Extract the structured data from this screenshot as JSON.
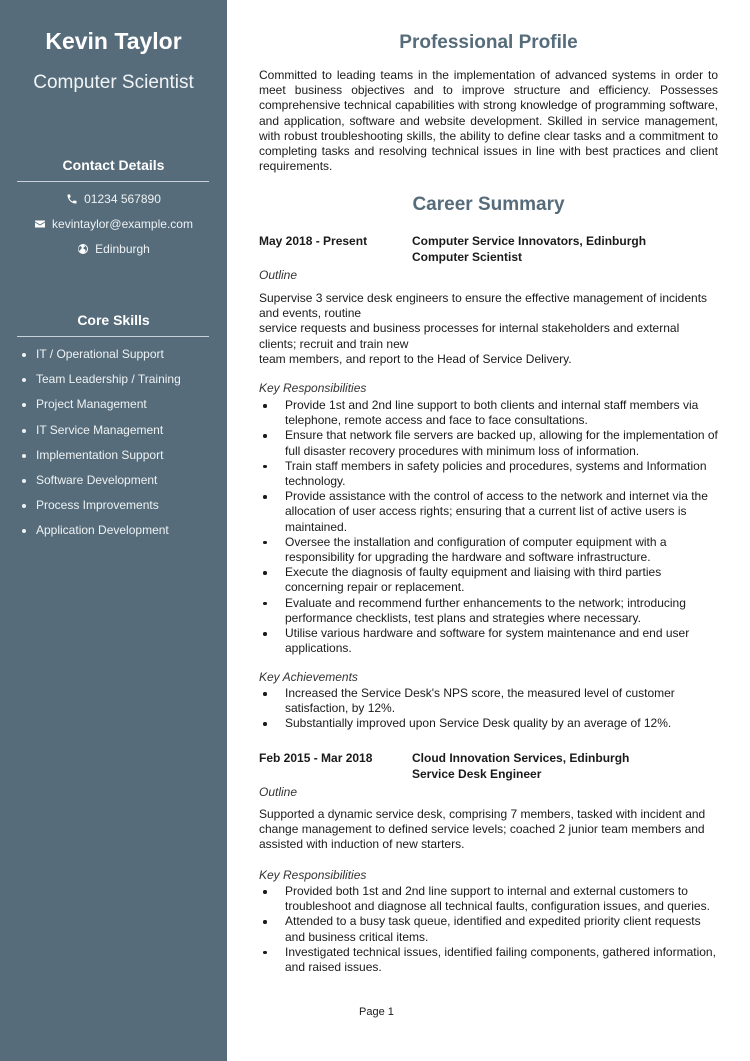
{
  "sidebar": {
    "name": "Kevin Taylor",
    "job_title": "Computer Scientist",
    "contact_heading": "Contact Details",
    "contact": [
      {
        "icon": "phone-icon",
        "text": "01234 567890"
      },
      {
        "icon": "envelope-icon",
        "text": "kevintaylor@example.com"
      },
      {
        "icon": "globe-icon",
        "text": "Edinburgh"
      }
    ],
    "skills_heading": "Core Skills",
    "skills": [
      "IT / Operational Support",
      "Team Leadership / Training",
      "Project Management",
      "IT Service Management",
      "Implementation Support",
      "Software Development",
      "Process Improvements",
      "Application Development"
    ]
  },
  "profile": {
    "heading": "Professional Profile",
    "text": "Committed to leading teams in the implementation of advanced systems in order to meet business objectives and to improve structure and efficiency. Possesses comprehensive technical capabilities with strong knowledge of programming software, and application, software and website development. Skilled in service management, with robust troubleshooting skills, the ability to define clear tasks and a commitment to completing tasks and resolving technical issues in line with best practices and client requirements."
  },
  "career": {
    "heading": "Career Summary",
    "jobs": [
      {
        "dates": "May 2018 - Present",
        "company": "Computer Service Innovators, Edinburgh",
        "role": "Computer Scientist",
        "outline_label": "Outline",
        "outline_lines": [
          "Supervise 3 service desk engineers to ensure the effective management of incidents and events, routine",
          "service requests and business processes for internal stakeholders and external clients; recruit and train new",
          "team members, and report to the Head of Service Delivery."
        ],
        "responsibilities_label": "Key Responsibilities",
        "responsibilities": [
          "Provide 1st and 2nd line support to both clients and internal staff members via telephone, remote access and face to face consultations.",
          "Ensure that network file servers are backed up, allowing for the implementation of full disaster recovery procedures with minimum loss of information.",
          "Train staff members in safety policies and procedures, systems and Information technology.",
          "Provide assistance with the control of access to the network and internet via the allocation of user access rights; ensuring that a current list of active users is maintained.",
          "Oversee the installation and configuration of computer equipment with a responsibility for upgrading the hardware and software infrastructure.",
          "Execute the diagnosis of faulty equipment and liaising with third parties concerning repair or replacement.",
          "Evaluate and recommend further enhancements to the network; introducing performance checklists, test plans and strategies where necessary.",
          "Utilise various hardware and software for system maintenance and end user applications."
        ],
        "achievements_label": "Key Achievements",
        "achievements": [
          "Increased the Service Desk's NPS score, the measured level of customer satisfaction, by 12%.",
          "Substantially improved upon Service Desk quality by an average of 12%."
        ]
      },
      {
        "dates": "Feb 2015 - Mar 2018",
        "company": "Cloud Innovation Services, Edinburgh",
        "role": "Service Desk Engineer",
        "outline_label": "Outline",
        "outline": "Supported a dynamic service desk, comprising 7 members, tasked with incident and change management to defined service levels; coached 2 junior team members and assisted with induction of new starters.",
        "responsibilities_label": "Key Responsibilities",
        "responsibilities": [
          "Provided both 1st and 2nd line support to internal and external customers to troubleshoot and diagnose all technical faults, configuration issues, and queries.",
          "Attended to a busy task queue, identified and expedited priority client requests and business critical items.",
          "Investigated technical issues, identified failing components, gathered information, and raised issues."
        ]
      }
    ]
  },
  "footer": {
    "page": "Page 1"
  }
}
